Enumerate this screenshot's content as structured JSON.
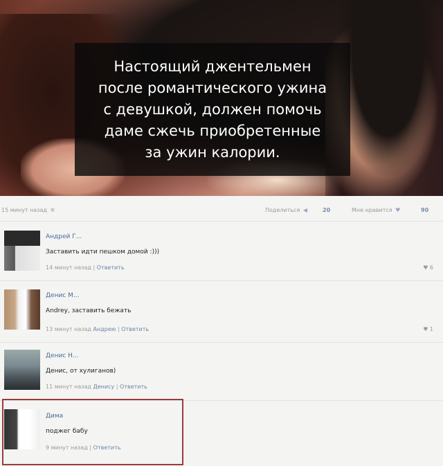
{
  "post": {
    "caption": "Настоящий джентельмен\nпосле романтического ужина\nс девушкой, должен помочь\nдаме сжечь приобретенные\nза ужин калории.",
    "time": "15 минут назад",
    "share_label": "Поделиться",
    "share_count": "20",
    "like_label": "Мне нравится",
    "like_count": "90"
  },
  "comments": [
    {
      "name": "Андрей Г...",
      "text": "Заставить идти пешком домой :)))",
      "time": "14 минут назад",
      "reply_to": "",
      "reply_label": "Ответить",
      "likes": "6"
    },
    {
      "name": "Денис М...",
      "text": "Andrey, заставить бежать",
      "time": "13 минут назад",
      "reply_to": "Андрею",
      "reply_label": "Ответить",
      "likes": "1"
    },
    {
      "name": "Денис Н...",
      "text": "Денис, от хулиганов)",
      "time": "11 минут назад",
      "reply_to": "Денису",
      "reply_label": "Ответить",
      "likes": ""
    },
    {
      "name": "Дима",
      "text": "поджег бабу",
      "time": "9 минут назад",
      "reply_to": "",
      "reply_label": "Ответить",
      "likes": ""
    }
  ],
  "icons": {
    "share": "megaphone-icon",
    "like": "heart-icon",
    "options": "gear-icon"
  },
  "colors": {
    "link": "#4a6a99",
    "highlight_border": "#9a3a3a"
  }
}
